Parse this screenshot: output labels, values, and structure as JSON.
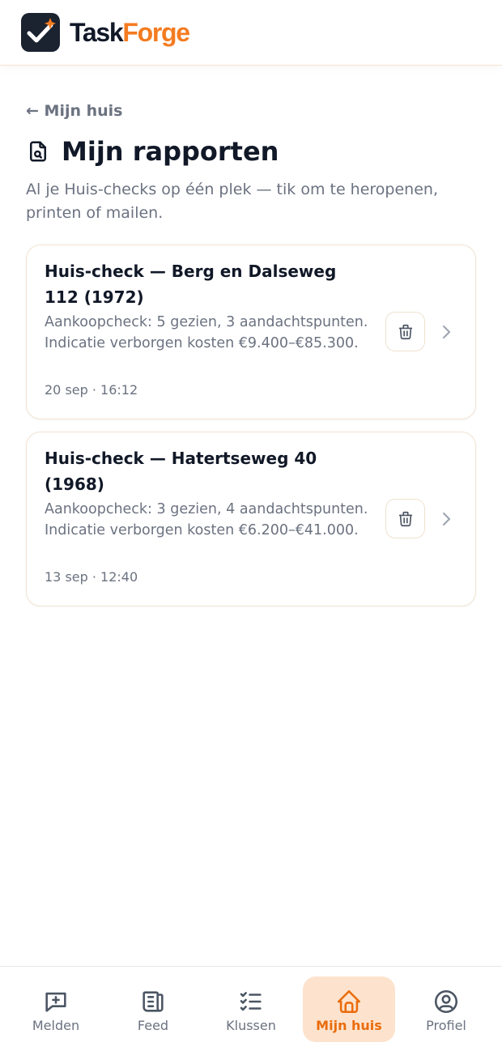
{
  "brand": {
    "part1": "Task",
    "part2": "Forge"
  },
  "nav_back": "← Mijn huis",
  "page": {
    "title": "Mijn rapporten",
    "subtitle": "Al je Huis-checks op één plek — tik om te heropenen, printen of mailen."
  },
  "reports": [
    {
      "title": "Huis-check — Berg en Dalseweg 112 (1972)",
      "description": "Aankoopcheck: 5 gezien, 3 aandachtspunten. Indicatie verborgen kosten €9.400–€85.300.",
      "date": "20 sep · 16:12"
    },
    {
      "title": "Huis-check — Hatertseweg 40 (1968)",
      "description": "Aankoopcheck: 3 gezien, 4 aandachtspunten. Indicatie verborgen kosten €6.200–€41.000.",
      "date": "13 sep · 12:40"
    }
  ],
  "bottom_nav": {
    "items": [
      {
        "label": "Melden",
        "icon": "message-plus-icon"
      },
      {
        "label": "Feed",
        "icon": "newspaper-icon"
      },
      {
        "label": "Klussen",
        "icon": "checklist-icon"
      },
      {
        "label": "Mijn huis",
        "icon": "home-icon"
      },
      {
        "label": "Profiel",
        "icon": "user-circle-icon"
      }
    ],
    "active_index": 3
  },
  "colors": {
    "brand_orange": "#f47b20",
    "active_nav_bg": "#fde3cd",
    "text_dark": "#111827",
    "text_muted": "#6b7280"
  }
}
